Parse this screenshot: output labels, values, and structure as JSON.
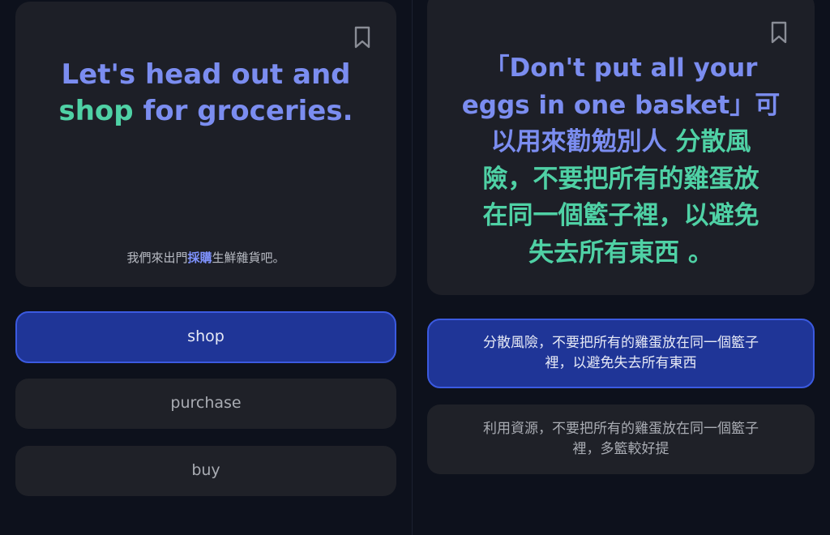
{
  "left": {
    "phrase": {
      "line1": "Let's head out and",
      "word": "shop",
      "rest": " for groceries."
    },
    "translation": {
      "before": "我們來出門",
      "highlight": "採購",
      "after": "生鮮雜貨吧。"
    },
    "options": [
      {
        "label": "shop",
        "selected": true
      },
      {
        "label": "purchase",
        "selected": false
      },
      {
        "label": "buy",
        "selected": false
      }
    ]
  },
  "right": {
    "phrase": {
      "line1": "「Don't put all your",
      "line2": "eggs in one basket」可",
      "line3_blue": "以用來勸勉別人 ",
      "line3_green": "分散風",
      "line4": "險，不要把所有的雞蛋放",
      "line5": "在同一個籃子裡，以避免",
      "line6": "失去所有東西 。"
    },
    "options": [
      {
        "line1": "分散風險，不要把所有的雞蛋放在同一個籃子",
        "line2": "裡，以避免失去所有東西",
        "selected": true
      },
      {
        "line1": "利用資源，不要把所有的雞蛋放在同一個籃子",
        "line2": "裡，多籃較好提",
        "selected": false
      }
    ]
  },
  "colors": {
    "background": "#0d111c",
    "card": "#1d1f27",
    "accent_blue": "#7b8df0",
    "accent_green": "#4fd1a5",
    "selected_fill": "#1f3597"
  },
  "icons": {
    "bookmark": "bookmark-icon"
  }
}
